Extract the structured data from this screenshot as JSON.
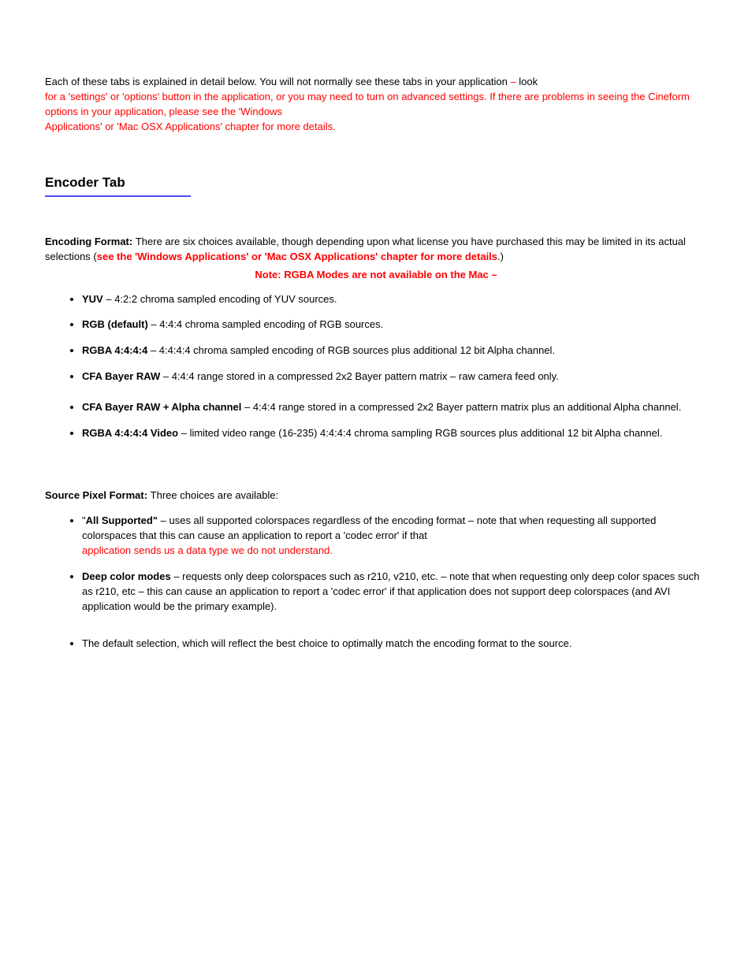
{
  "intro": {
    "s1": "Each of these tabs is explained in detail below.  You will not normally see these tabs in your application ",
    "s2": "– ",
    "s3": "look ",
    "s4": "for a 'settings' or 'options' button in the application",
    "s5": ", or you may need to turn on advanced settings.  If there are problems in seeing the Cineform options in your application",
    "s6": ", please see the '",
    "s7": "Windows ",
    "s8": "Applications' or 'Mac OSX Applications' chapter for more details."
  },
  "encoderTab": {
    "title": "Encoder Tab"
  },
  "encodingFormat": {
    "lead": "There are six choices available, though depending upon what license you have purchased this may be limited in its actual selections (",
    "leadHi": "see the 'Windows Applications' or 'Mac OSX Applications' chapter for more details",
    "leadEnd": ".)",
    "note": "Note: RGBA Modes are not available on the Mac",
    "dash": " – ",
    "items": [
      {
        "name": "YUV",
        "sep": " – ",
        "desc": "4:2:2 chroma sampled encoding of YUV sources."
      },
      {
        "name": "RGB (default)",
        "sep": " – ",
        "desc": "4:4:4 chroma sampled encoding of RGB sources."
      },
      {
        "name": "RGBA 4:4:4:4",
        "sep": " – ",
        "desc": "4:4:4:4 chroma sampled encoding of RGB sources plus additional 12 bit Alpha channel."
      },
      {
        "name": "CFA Bayer RAW",
        "sep": " – ",
        "desc": "4:4:4 range stored in a compressed 2x2 Bayer pattern matrix ",
        "tail": "– raw camera feed only."
      },
      {
        "name": "CFA Bayer RAW + Alpha channel",
        "sep": " – ",
        "desc": "4:4:4 range stored in a compressed 2x2 Bayer pattern matrix plus an additional Alpha channel."
      },
      {
        "name": "RGBA 4:4:4:4 Video",
        "sep": " – ",
        "desc": "limited video range (16-235) 4:4:4:4 chroma sampling RGB sources plus additional 12 bit Alpha channel."
      }
    ]
  },
  "source": {
    "intro": "Three choices are available:",
    "items": [
      {
        "pre": "\"",
        "name": "All Supported\"",
        "sep": " – ",
        "desc": "uses all supported colorspaces regardless of the encoding format ",
        "tail": "– note that when requesting all supported colorspaces that this can cause an application to report a 'codec error' if that ",
        "trail": "application sends us a data type  we do not understand."
      },
      {
        "pre": "",
        "name": "Deep color modes",
        "sep": " – ",
        "desc": "requests only deep colorspaces such as r210, v210, etc. ",
        "tail": "– note that when requesting only deep color spaces such as r210, etc ",
        "trail": "– this can cause an application to report a 'codec error' if that application does not support deep colorspaces (and AVI application would be the primary example)."
      },
      {
        "pre": "",
        "name": "",
        "sep": "",
        "desc": "The default selection, which will reflect the best choice to optimally match the encoding format to the source.",
        "tail": ""
      }
    ]
  }
}
